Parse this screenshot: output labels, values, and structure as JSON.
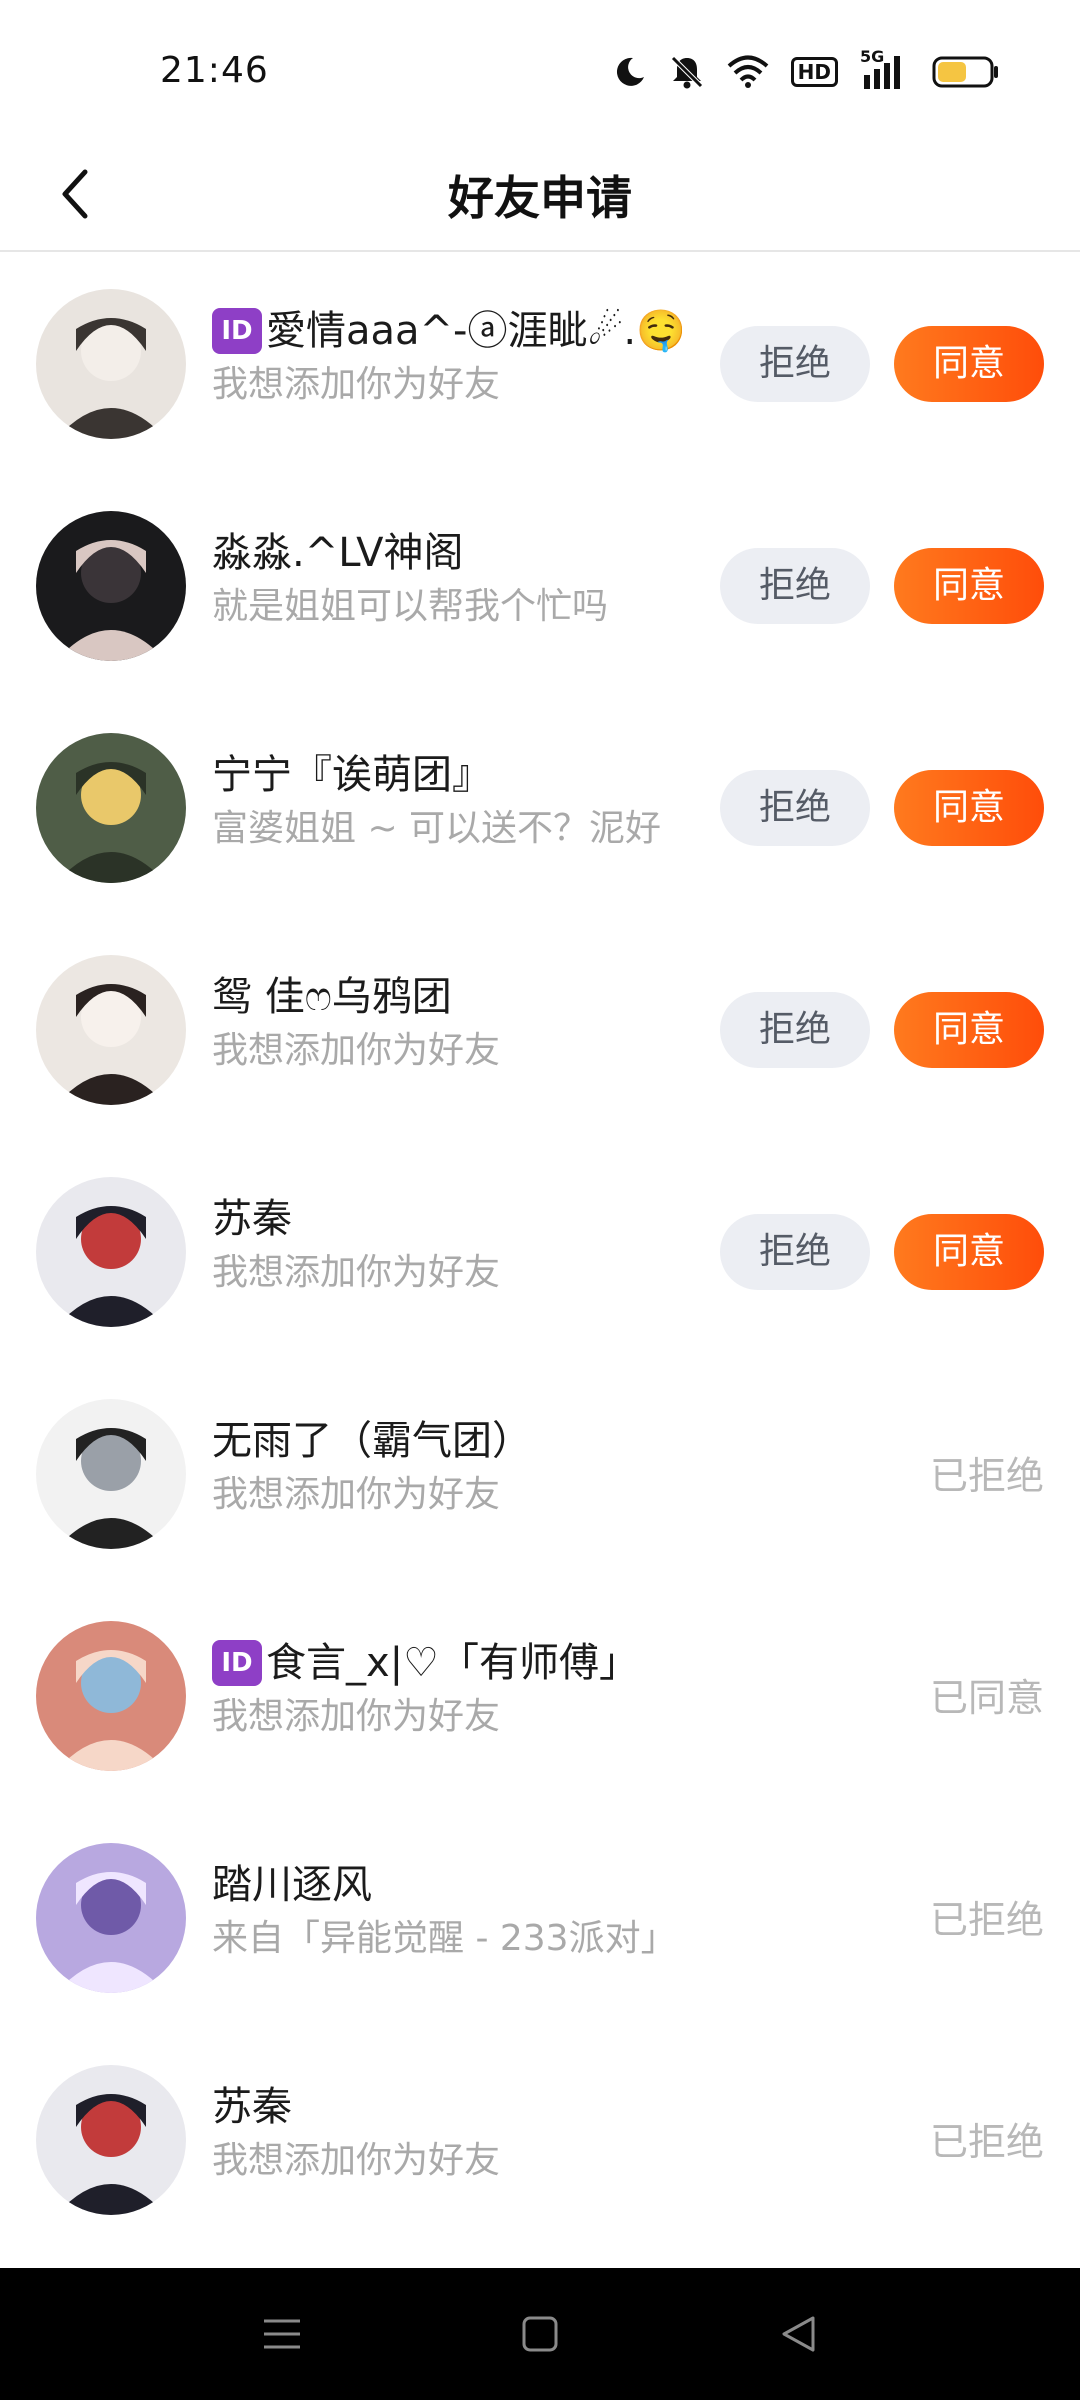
{
  "status_bar": {
    "time": "21:46",
    "hd_label": "HD",
    "network_label": "5G",
    "icons": [
      "moon-icon",
      "bell-muted-icon",
      "wifi-icon",
      "hd-icon",
      "signal-5g-icon",
      "battery-icon"
    ],
    "battery_level": 0.55,
    "battery_color": "#f5c542"
  },
  "header": {
    "title": "好友申请",
    "back_icon": "chevron-left-icon"
  },
  "colors": {
    "accent": "#ff5a10",
    "reject_bg": "#eceef3",
    "muted_text": "#a9a9a9",
    "status_text": "#b8b8b8",
    "id_badge": "#8e3fc6"
  },
  "buttons": {
    "reject_label": "拒绝",
    "accept_label": "同意"
  },
  "requests": [
    {
      "id_badge": "ID",
      "name": "愛情aaa^-ⓐ涯眦☄.🤤",
      "message": "我想添加你为好友",
      "status": ""
    },
    {
      "id_badge": "",
      "name": "淼淼.^LV神阁",
      "message": "就是姐姐可以帮我个忙吗",
      "status": ""
    },
    {
      "id_badge": "",
      "name": "宁宁『诶萌团』",
      "message": "富婆姐姐 ~ 可以送不？泥好",
      "status": ""
    },
    {
      "id_badge": "",
      "name": "鸳 佳ෆ乌鸦团",
      "message": "我想添加你为好友",
      "status": ""
    },
    {
      "id_badge": "",
      "name": "苏秦",
      "message": "我想添加你为好友",
      "status": ""
    },
    {
      "id_badge": "",
      "name": "无雨了（霸气团）",
      "message": "我想添加你为好友",
      "status": "已拒绝"
    },
    {
      "id_badge": "ID",
      "name": "食言_x|♡「有师傅」",
      "message": "我想添加你为好友",
      "status": "已同意"
    },
    {
      "id_badge": "",
      "name": "踏川逐风",
      "message": "来自「异能觉醒 - 233派对」",
      "status": "已拒绝"
    },
    {
      "id_badge": "",
      "name": "苏秦",
      "message": "我想添加你为好友",
      "status": "已拒绝"
    }
  ],
  "nav_bar": {
    "icons": [
      "menu-icon",
      "home-square-icon",
      "back-triangle-icon"
    ]
  }
}
